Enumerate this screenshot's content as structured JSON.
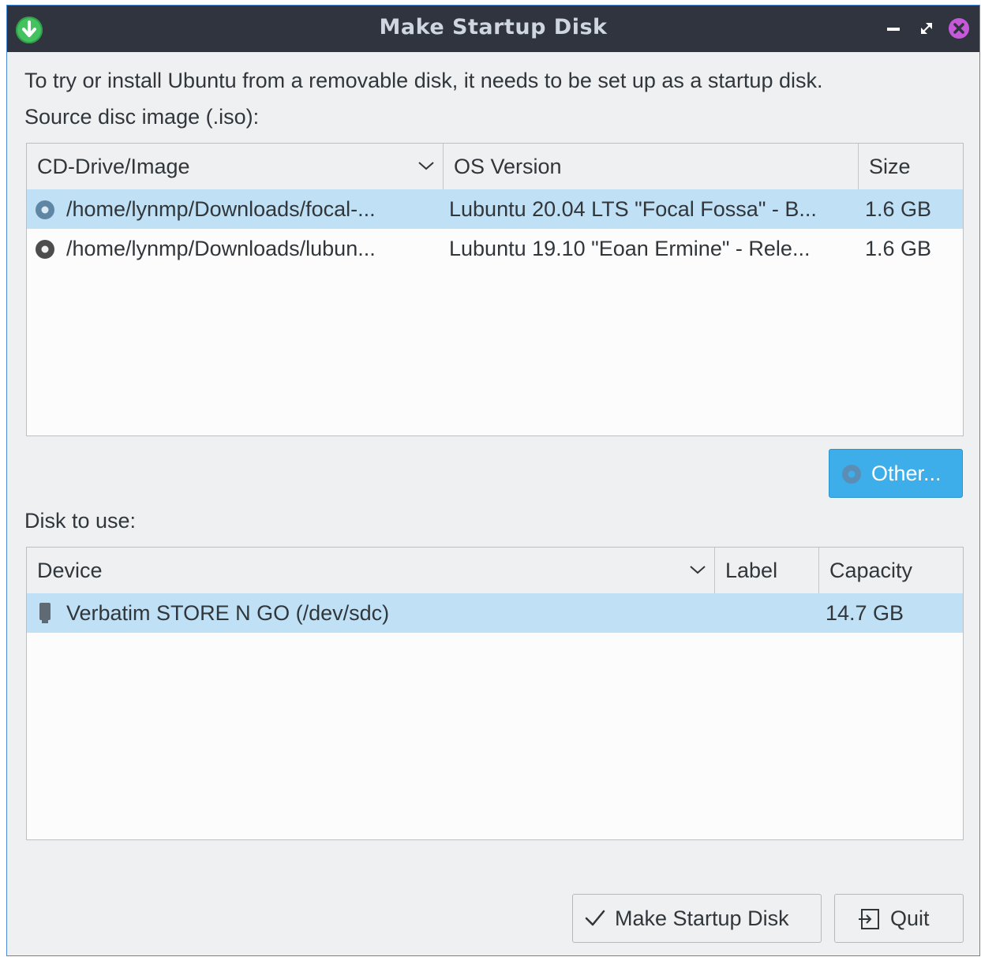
{
  "window": {
    "title": "Make Startup Disk",
    "controls": {
      "minimize": "minimize-icon",
      "maximize": "restore-icon",
      "close": "close-icon"
    }
  },
  "intro_text": "To try or install Ubuntu from a removable disk, it needs to be set up as a startup disk.",
  "source": {
    "label": "Source disc image (.iso):",
    "columns": [
      "CD-Drive/Image",
      "OS Version",
      "Size"
    ],
    "rows": [
      {
        "path": "/home/lynmp/Downloads/focal-...",
        "os": "Lubuntu 20.04 LTS \"Focal Fossa\" - B...",
        "size": "1.6 GB",
        "selected": true
      },
      {
        "path": "/home/lynmp/Downloads/lubun...",
        "os": "Lubuntu 19.10 \"Eoan Ermine\" - Rele...",
        "size": "1.6 GB",
        "selected": false
      }
    ],
    "other_button": "Other..."
  },
  "disk": {
    "label": "Disk to use:",
    "columns": [
      "Device",
      "Label",
      "Capacity"
    ],
    "rows": [
      {
        "device": "Verbatim STORE N GO (/dev/sdc)",
        "label": "",
        "capacity": "14.7 GB",
        "selected": true
      }
    ]
  },
  "buttons": {
    "make": "Make Startup Disk",
    "quit": "Quit"
  },
  "colors": {
    "titlebar": "#2f343f",
    "accent": "#3daee9",
    "selection": "#bfe0f5",
    "app_icon": "#45c260",
    "close": "#c659d8"
  }
}
